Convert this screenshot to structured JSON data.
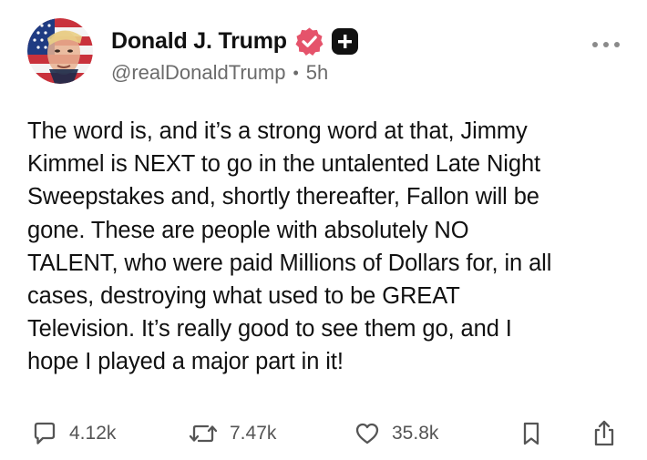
{
  "post": {
    "author": {
      "display_name": "Donald J. Trump",
      "handle": "@realDonaldTrump",
      "separator": "•",
      "time_ago": "5h",
      "verified_icon": "verified-badge-icon",
      "extra_icon": "plus-icon",
      "avatar": "avatar"
    },
    "body": "The word is, and it’s a strong word at that, Jimmy\nKimmel is NEXT to go in the untalented Late Night\nSweepstakes and, shortly thereafter, Fallon will be\ngone. These are people with absolutely NO\nTALENT, who were paid Millions of Dollars for, in all\ncases, destroying what used to be GREAT\nTelevision. It’s really good to see them go, and I\nhope I played a major part in it!",
    "actions": {
      "replies": "4.12k",
      "retruths": "7.47k",
      "likes": "35.8k"
    }
  },
  "colors": {
    "text": "#111111",
    "muted": "#6b6b6b",
    "verified_badge": "#e5536b",
    "icon_stroke": "#555555"
  }
}
